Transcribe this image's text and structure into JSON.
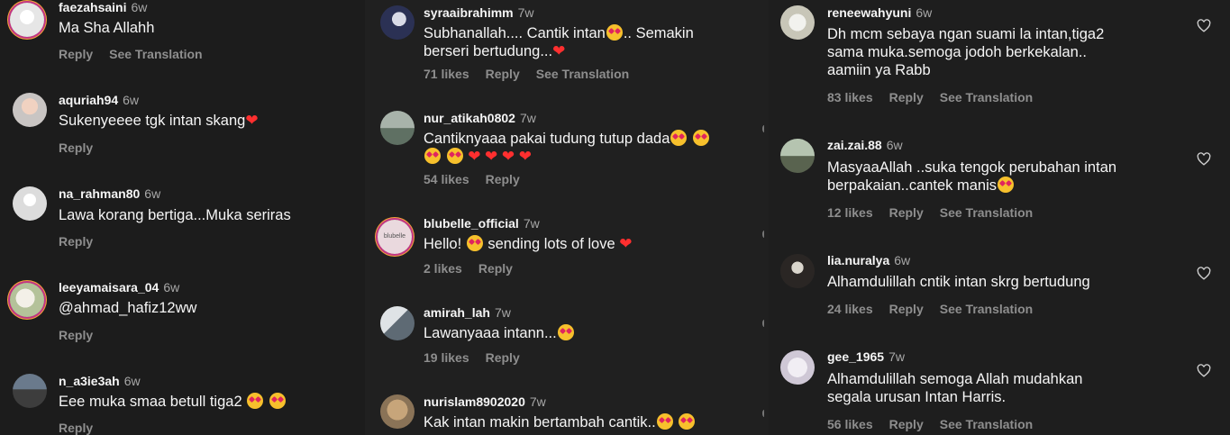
{
  "colors": {
    "bg": "#1f1f1f",
    "meta": "#8e8e8e",
    "heart": "#ff2f2f"
  },
  "col1": [
    {
      "user": "faezahsaini",
      "time": "6w",
      "text": "Ma Sha Allahh",
      "likes": "",
      "reply": "Reply",
      "translate": "See Translation"
    },
    {
      "user": "aquriah94",
      "time": "6w",
      "text": "Sukenyeeee tgk intan skang",
      "likes": "",
      "reply": "Reply",
      "translate": ""
    },
    {
      "user": "na_rahman80",
      "time": "6w",
      "text": "Lawa korang bertiga...Muka seriras",
      "likes": "",
      "reply": "Reply",
      "translate": ""
    },
    {
      "user": "leeyamaisara_04",
      "time": "6w",
      "text": "@ahmad_hafiz12ww",
      "likes": "",
      "reply": "Reply",
      "translate": ""
    },
    {
      "user": "n_a3ie3ah",
      "time": "6w",
      "text": "Eee muka smaa betull tiga2",
      "likes": "",
      "reply": "Reply",
      "translate": ""
    }
  ],
  "col2": [
    {
      "user": "syraaibrahimm",
      "time": "7w",
      "text": "Subhanallah.... Cantik intan",
      "text_b": ".. Semakin",
      "text2": "berseri bertudung...",
      "likes": "71 likes",
      "reply": "Reply",
      "translate": "See Translation"
    },
    {
      "user": "nur_atikah0802",
      "time": "7w",
      "text": "Cantiknyaaa pakai tudung tutup dada",
      "likes": "54 likes",
      "reply": "Reply",
      "translate": ""
    },
    {
      "user": "blubelle_official",
      "time": "7w",
      "text": "Hello!",
      "text_b": "sending lots of love",
      "avatar_text": "blubelle",
      "likes": "2 likes",
      "reply": "Reply",
      "translate": ""
    },
    {
      "user": "amirah_lah",
      "time": "7w",
      "text": "Lawanyaaa intann...",
      "likes": "19 likes",
      "reply": "Reply",
      "translate": ""
    },
    {
      "user": "nurislam8902020",
      "time": "7w",
      "text": "Kak intan makin bertambah cantik..",
      "likes": "",
      "reply": "",
      "translate": ""
    }
  ],
  "col3": [
    {
      "user": "reneewahyuni",
      "time": "6w",
      "text": "Dh mcm sebaya ngan suami la intan,tiga2\nsama muka.semoga jodoh berkekalan..\naamiin ya Rabb",
      "likes": "83 likes",
      "reply": "Reply",
      "translate": "See Translation"
    },
    {
      "user": "zai.zai.88",
      "time": "6w",
      "text": "MasyaaAllah ..suka tengok perubahan intan\nberpakaian..cantek manis",
      "likes": "12 likes",
      "reply": "Reply",
      "translate": "See Translation"
    },
    {
      "user": "lia.nuralya",
      "time": "6w",
      "text": "Alhamdulillah cntik intan skrg bertudung",
      "likes": "24 likes",
      "reply": "Reply",
      "translate": "See Translation"
    },
    {
      "user": "gee_1965",
      "time": "7w",
      "text": "Alhamdulillah semoga Allah mudahkan\nsegala urusan Intan Harris.",
      "likes": "56 likes",
      "reply": "Reply",
      "translate": "See Translation"
    }
  ]
}
